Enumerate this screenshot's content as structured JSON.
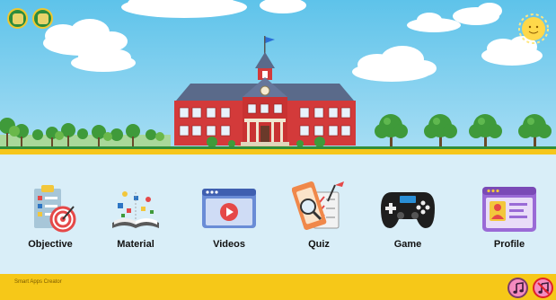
{
  "menu": {
    "items": [
      {
        "label": "Objective"
      },
      {
        "label": "Material"
      },
      {
        "label": "Videos"
      },
      {
        "label": "Quiz"
      },
      {
        "label": "Game"
      },
      {
        "label": "Profile"
      }
    ]
  },
  "footer": {
    "credit": "Smart Apps Creator"
  },
  "icons": {
    "logo_1": "school-crest-icon",
    "logo_2": "institution-crest-icon",
    "sun": "smiling-sun-icon",
    "music_on": "music-note-icon",
    "music_off": "music-off-icon"
  },
  "colors": {
    "sky": "#5ec3ea",
    "ground": "#f5c61c",
    "menu_background": "#d9eef8",
    "footer": "#f6c818",
    "school_wall": "#d33a3a",
    "roof": "#5a6a8a"
  }
}
